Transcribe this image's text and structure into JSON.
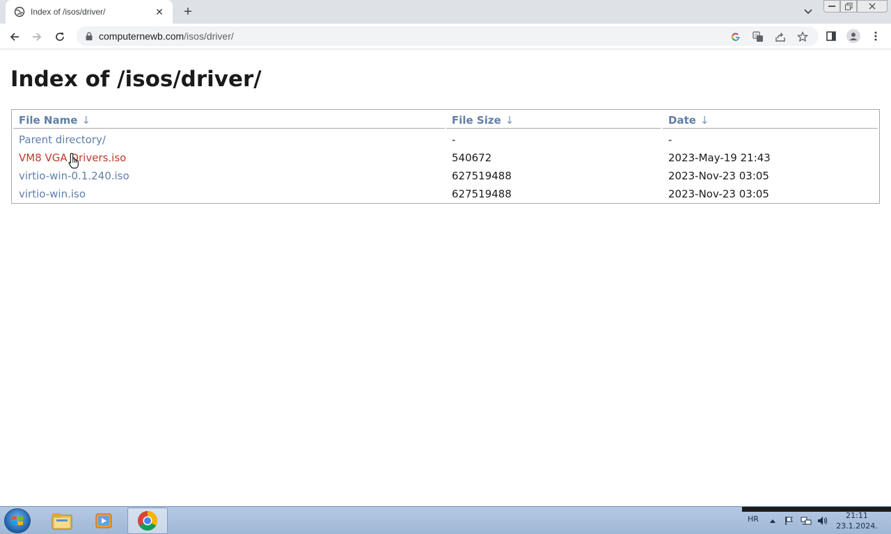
{
  "browser": {
    "tab_title": "Index of /isos/driver/",
    "new_tab_symbol": "+",
    "close_tab_symbol": "✕",
    "url_host": "computernewb.com",
    "url_path": "/isos/driver/"
  },
  "page": {
    "title": "Index of /isos/driver/",
    "columns": [
      {
        "label": "File Name",
        "arrow": "↓"
      },
      {
        "label": "File Size",
        "arrow": "↓"
      },
      {
        "label": "Date",
        "arrow": "↓"
      }
    ],
    "rows": [
      {
        "name": "Parent directory/",
        "size": "-",
        "date": "-"
      },
      {
        "name": "VM8 VGA Drivers.iso",
        "size": "540672",
        "date": "2023-May-19 21:43"
      },
      {
        "name": "virtio-win-0.1.240.iso",
        "size": "627519488",
        "date": "2023-Nov-23 03:05"
      },
      {
        "name": "virtio-win.iso",
        "size": "627519488",
        "date": "2023-Nov-23 03:05"
      }
    ],
    "hovered_row": 1
  },
  "taskbar": {
    "language": "HR",
    "time": "21:11",
    "date": "23.1.2024."
  },
  "colors": {
    "link": "#5f7fa8",
    "link_hover": "#c0392b",
    "tabstrip": "#dee1e6"
  },
  "icons": {
    "tab_favicon": "globe-icon",
    "back": "back-arrow-icon",
    "forward": "forward-arrow-icon",
    "reload": "reload-icon",
    "lock": "lock-icon",
    "google": "google-icon",
    "translate": "translate-icon",
    "share": "share-icon",
    "bookmark": "star-icon",
    "side_panel": "side-panel-icon",
    "profile": "profile-icon",
    "menu": "kebab-menu-icon"
  }
}
